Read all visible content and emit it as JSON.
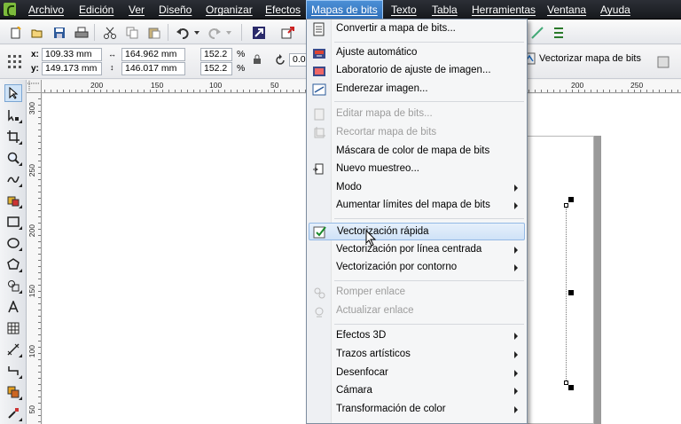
{
  "menubar": {
    "items": [
      "Archivo",
      "Edición",
      "Ver",
      "Diseño",
      "Organizar",
      "Efectos",
      "Mapas de bits",
      "Texto",
      "Tabla",
      "Herramientas",
      "Ventana",
      "Ayuda"
    ],
    "active": "Mapas de bits"
  },
  "property_bar": {
    "x_label": "x:",
    "x_value": "109.33 mm",
    "y_label": "y:",
    "y_value": "149.173 mm",
    "width_value": "164.962 mm",
    "height_value": "146.017 mm",
    "scale_x": "152.2",
    "scale_y": "152.2",
    "percent": "%",
    "rotation": "0.0",
    "vectorize_label": "Vectorizar mapa de bits"
  },
  "ruler": {
    "h_ticks_left": [
      "200",
      "150",
      "100",
      "50"
    ],
    "h_ticks_right": [
      "200",
      "250"
    ],
    "v_ticks": [
      "300",
      "250",
      "200",
      "150",
      "100",
      "50"
    ]
  },
  "dropdown": {
    "items": [
      {
        "label": "Convertir a mapa de bits...",
        "icon": "convert-bitmap-icon"
      },
      {
        "label": "Ajuste automático",
        "icon": "auto-adjust-icon"
      },
      {
        "label": "Laboratorio de ajuste de imagen...",
        "icon": "image-lab-icon"
      },
      {
        "label": "Enderezar imagen...",
        "icon": "straighten-icon"
      },
      {
        "label": "Editar mapa de bits...",
        "icon": "edit-bitmap-icon"
      },
      {
        "label": "Recortar mapa de bits",
        "icon": "crop-bitmap-icon"
      },
      {
        "label": "Máscara de color de mapa de bits"
      },
      {
        "label": "Nuevo muestreo...",
        "icon": "resample-icon"
      },
      {
        "label": "Modo"
      },
      {
        "label": "Aumentar límites del mapa de bits"
      },
      {
        "label": "Vectorización rápida",
        "icon": "quick-trace-icon"
      },
      {
        "label": "Vectorización por línea centrada"
      },
      {
        "label": "Vectorización por contorno"
      },
      {
        "label": "Romper enlace",
        "icon": "break-link-icon"
      },
      {
        "label": "Actualizar enlace",
        "icon": "update-link-icon"
      },
      {
        "label": "Efectos 3D"
      },
      {
        "label": "Trazos artísticos"
      },
      {
        "label": "Desenfocar"
      },
      {
        "label": "Cámara"
      },
      {
        "label": "Transformación de color"
      }
    ],
    "highlighted": "Vectorización rápida",
    "disabled": [
      "Editar mapa de bits...",
      "Recortar mapa de bits",
      "Romper enlace",
      "Actualizar enlace"
    ]
  },
  "colors": {
    "menubar_bg": "#1e2025",
    "highlight": "#cfe2f7",
    "active_menu": "#3a7cc6"
  }
}
